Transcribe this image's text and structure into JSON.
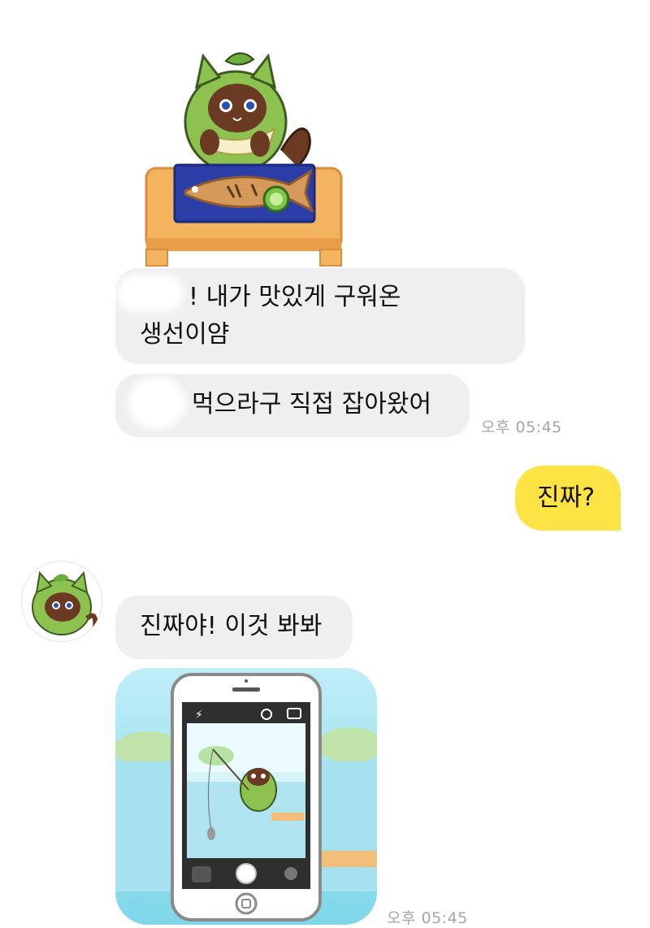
{
  "messages": {
    "m1_line1": "! 내가 맛있게 구워온",
    "m1_line2": "생선이얌",
    "m2": "먹으라구 직접 잡아왔어",
    "m2_time": "오후 05:45",
    "sent1": "진짜?",
    "m3": "진짜야! 이것 봐봐",
    "m4_time": "오후 05:45"
  },
  "colors": {
    "incoming_bubble": "#efeff1",
    "outgoing_bubble": "#fde343",
    "timestamp": "#a5a5a9"
  },
  "icons": {
    "sticker_1": "cat-grilled-fish-sticker",
    "sticker_2": "cat-phone-fishing-sticker",
    "avatar": "cat-avatar"
  }
}
